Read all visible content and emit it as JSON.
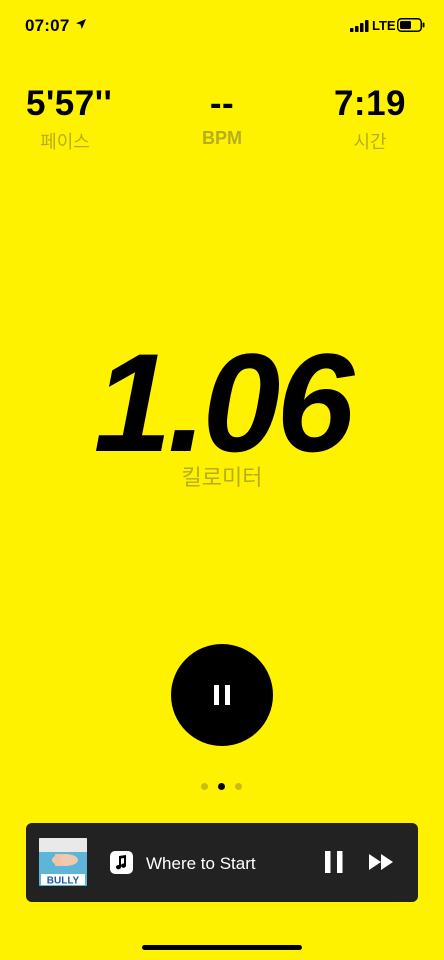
{
  "status_bar": {
    "time": "07:07",
    "network": "LTE",
    "icons": [
      "location-arrow-icon",
      "signal-bars-icon",
      "battery-icon"
    ]
  },
  "stats": {
    "pace": {
      "value": "5'57''",
      "label": "페이스"
    },
    "bpm": {
      "value": "--",
      "label": "BPM"
    },
    "duration": {
      "value": "7:19",
      "label": "시간"
    }
  },
  "distance": {
    "value": "1.06",
    "unit": "킬로미터"
  },
  "controls": {
    "pause_icon": "pause-icon"
  },
  "pager": {
    "count": 3,
    "active_index": 1
  },
  "now_playing": {
    "album_text": "BULLY",
    "app_icon": "music-note-icon",
    "title": "Where to Start"
  },
  "colors": {
    "background": "#FFF200",
    "label": "#B7AE1F",
    "player_bg": "#222222"
  }
}
